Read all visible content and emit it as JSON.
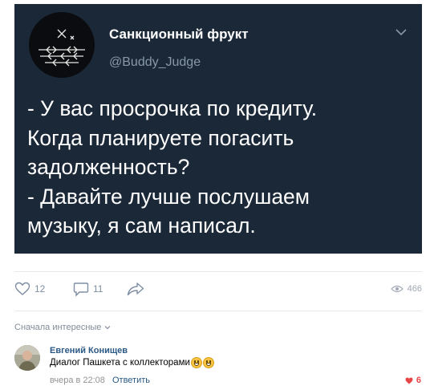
{
  "tweet": {
    "display_name": "Санкционный фрукт",
    "handle": "@Buddy_Judge",
    "text_lines": [
      "- У вас просрочка по кредиту.",
      "Когда планируете погасить",
      "задолженность?",
      "- Давайте лучше послушаем",
      "музыку, я сам написал."
    ]
  },
  "post_actions": {
    "likes": "12",
    "comments": "11",
    "views": "466"
  },
  "comments_section": {
    "sort_label": "Сначала интересные",
    "comment": {
      "author": "Евгений Конищев",
      "text": "Диалог Пашкета с коллекторами",
      "time": "вчера в 22:08",
      "reply_label": "Ответить",
      "likes": "6"
    }
  },
  "icons": {
    "chevron": "chevron-down-icon",
    "like": "heart-icon",
    "comment": "comment-icon",
    "share": "share-icon",
    "views": "eye-icon",
    "comment_like": "heart-filled-icon",
    "emoji": "grin-emoji-icon"
  },
  "colors": {
    "tweet_bg": "#1b2837",
    "link": "#2a5885",
    "like_red": "#e64646"
  }
}
